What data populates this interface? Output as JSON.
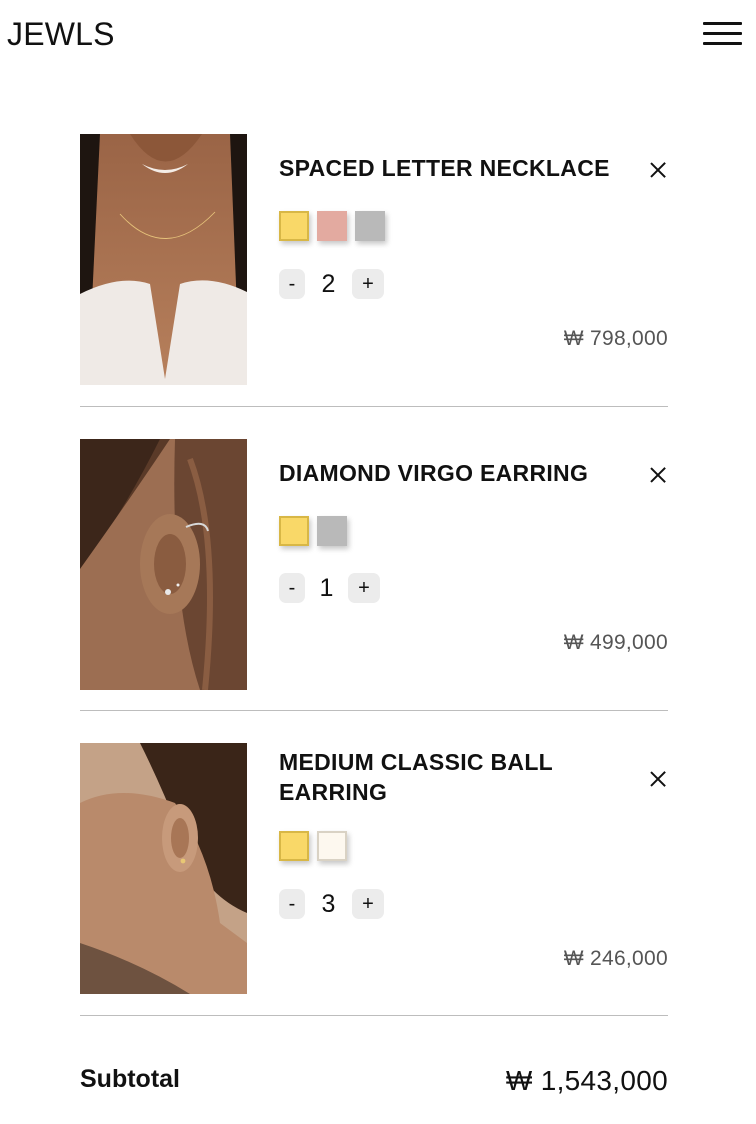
{
  "header": {
    "logo": "JEWLS"
  },
  "cart": {
    "items": [
      {
        "name": "SPACED LETTER NECKLACE",
        "swatches": [
          "#f9d868",
          "#e3aaa0",
          "#b9b9b9"
        ],
        "selected_swatch": 0,
        "quantity": "2",
        "minus": "-",
        "plus": "+",
        "price": "₩ 798,000"
      },
      {
        "name": "DIAMOND VIRGO EARRING",
        "swatches": [
          "#f9d868",
          "#b9b9b9"
        ],
        "selected_swatch": 0,
        "quantity": "1",
        "minus": "-",
        "plus": "+",
        "price": "₩ 499,000"
      },
      {
        "name": "MEDIUM CLASSIC BALL EARRING",
        "swatches": [
          "#f9d868",
          "#fdf8ef"
        ],
        "selected_swatch": 0,
        "quantity": "3",
        "minus": "-",
        "plus": "+",
        "price": "₩ 246,000"
      }
    ]
  },
  "summary": {
    "subtotal_label": "Subtotal",
    "subtotal_value": "₩ 1,543,000"
  }
}
